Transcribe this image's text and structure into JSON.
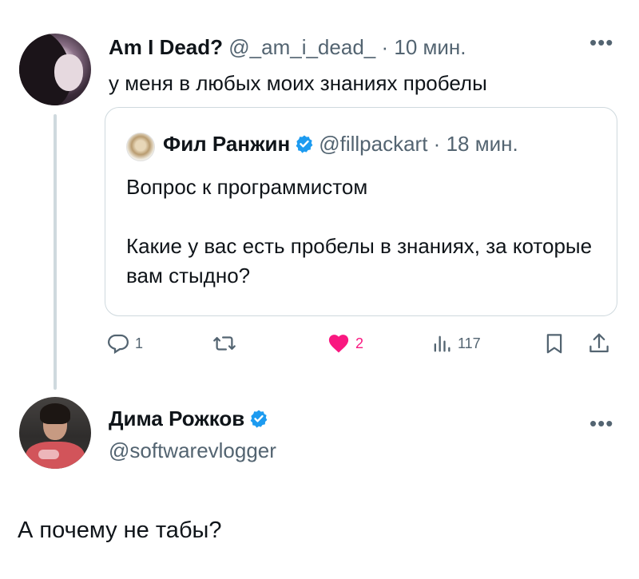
{
  "tweet1": {
    "display_name": "Am I Dead?",
    "handle": "@_am_i_dead_",
    "separator": "·",
    "time": "10 мин.",
    "text": "у меня в любых моих знаниях пробелы",
    "more_icon": "more-horizontal-icon"
  },
  "quote": {
    "display_name": "Фил Ранжин",
    "handle": "@fillpackart",
    "separator": "·",
    "time": "18 мин.",
    "line1": "Вопрос к программистом",
    "line2": "Какие у вас есть пробелы в знаниях, за которые вам стыдно?"
  },
  "actions": {
    "reply_count": "1",
    "like_count": "2",
    "views_count": "117",
    "icons": [
      "reply-icon",
      "retweet-icon",
      "like-icon",
      "views-icon",
      "bookmark-icon",
      "share-icon"
    ]
  },
  "tweet2": {
    "display_name": "Дима Рожков",
    "handle": "@softwarevlogger",
    "text": "А почему не табы?"
  },
  "colors": {
    "verified": "#1d9bf0",
    "like": "#f91880",
    "muted": "#536471",
    "border": "#cfd9de"
  }
}
